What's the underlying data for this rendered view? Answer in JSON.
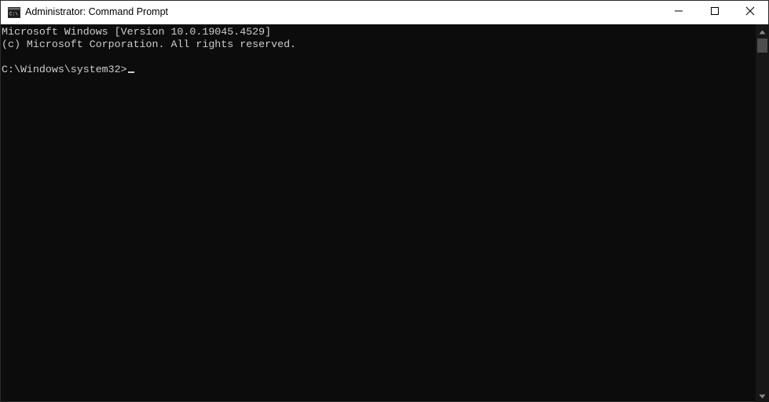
{
  "window": {
    "title": "Administrator: Command Prompt",
    "icon": "cmd-icon"
  },
  "caption_buttons": {
    "minimize_icon": "minimize-icon",
    "maximize_icon": "maximize-icon",
    "close_icon": "close-icon"
  },
  "console": {
    "line1": "Microsoft Windows [Version 10.0.19045.4529]",
    "line2": "(c) Microsoft Corporation. All rights reserved.",
    "prompt": "C:\\Windows\\system32>"
  },
  "colors": {
    "console_bg": "#0c0c0c",
    "console_text": "#cccccc",
    "titlebar_bg": "#ffffff",
    "scrollbar_thumb": "#4d4d4d"
  }
}
